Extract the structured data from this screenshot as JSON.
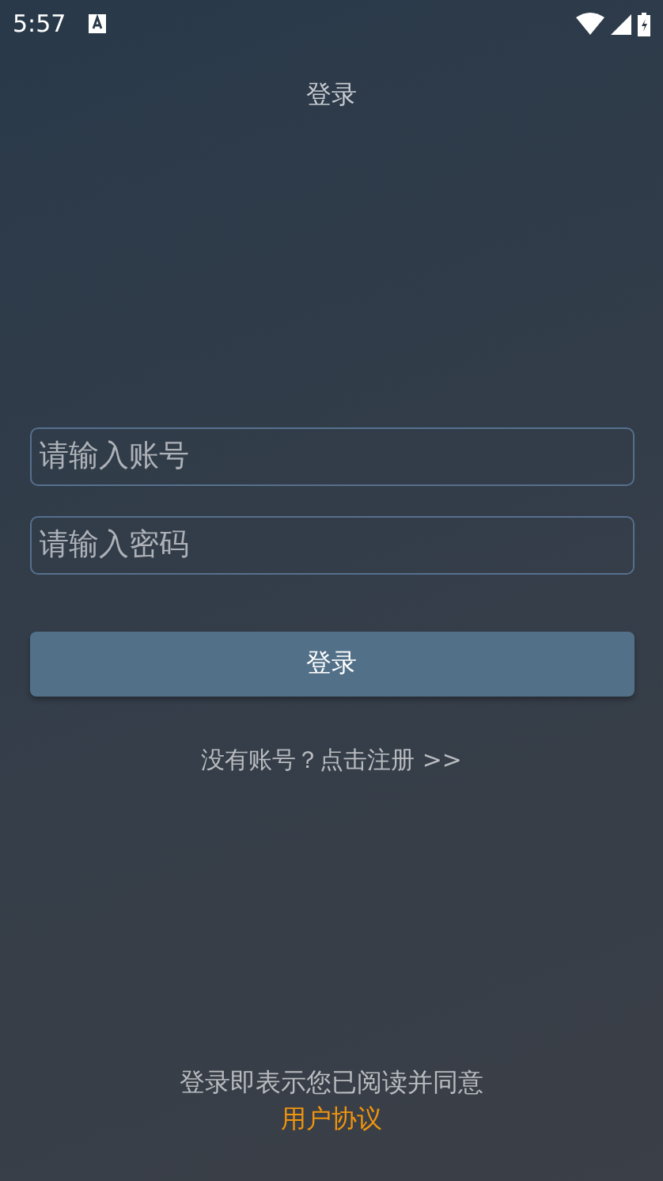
{
  "status_bar": {
    "time": "5:57"
  },
  "title": "登录",
  "fields": [
    {
      "placeholder": "请输入账号"
    },
    {
      "placeholder": "请输入密码"
    }
  ],
  "login_button": "登录",
  "register_link": "没有账号？点击注册 >>",
  "agreement": {
    "text": "登录即表示您已阅读并同意",
    "link": "用户协议"
  }
}
